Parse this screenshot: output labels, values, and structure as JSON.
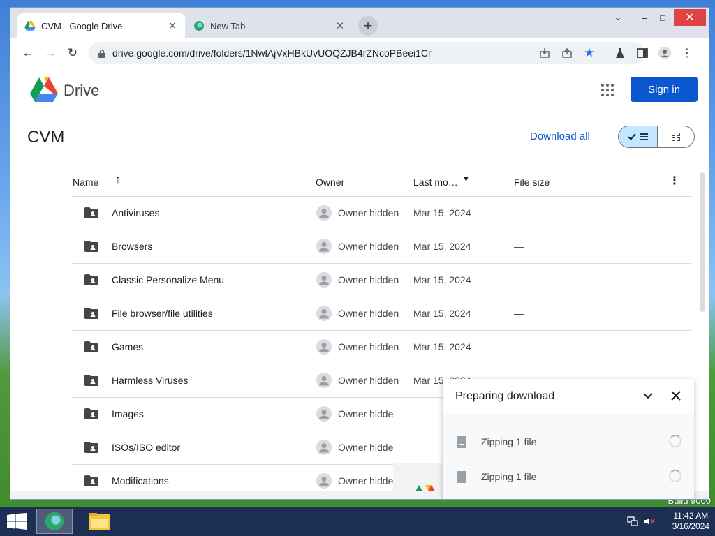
{
  "browser": {
    "tabs": [
      {
        "title": "CVM - Google Drive",
        "active": true
      },
      {
        "title": "New Tab",
        "active": false
      }
    ],
    "new_tab_label": "+",
    "url": "drive.google.com/drive/folders/1NwlAjVxHBkUvUOQZJB4rZNcoPBeei1Cr",
    "window_controls": {
      "collapse": "⌄",
      "minimize": "–",
      "maximize": "□",
      "close": "✕"
    }
  },
  "drive": {
    "brand": "Drive",
    "sign_in": "Sign in",
    "folder_title": "CVM",
    "download_all": "Download all",
    "columns": {
      "name": "Name",
      "owner": "Owner",
      "last_modified": "Last mo…",
      "file_size": "File size"
    },
    "rows": [
      {
        "name": "Antiviruses",
        "owner": "Owner hidden",
        "date": "Mar 15, 2024",
        "size": "—"
      },
      {
        "name": "Browsers",
        "owner": "Owner hidden",
        "date": "Mar 15, 2024",
        "size": "—"
      },
      {
        "name": "Classic Personalize Menu",
        "owner": "Owner hidden",
        "date": "Mar 15, 2024",
        "size": "—"
      },
      {
        "name": "File browser/file utilities",
        "owner": "Owner hidden",
        "date": "Mar 15, 2024",
        "size": "—"
      },
      {
        "name": "Games",
        "owner": "Owner hidden",
        "date": "Mar 15, 2024",
        "size": "—"
      },
      {
        "name": "Harmless Viruses",
        "owner": "Owner hidden",
        "date": "Mar 15, 2024",
        "size": "—"
      },
      {
        "name": "Images",
        "owner": "Owner hidde",
        "date": "",
        "size": ""
      },
      {
        "name": "ISOs/ISO editor",
        "owner": "Owner hidde",
        "date": "",
        "size": ""
      },
      {
        "name": "Modifications",
        "owner": "Owner hidde",
        "date": "Mar 15",
        "size": ""
      }
    ]
  },
  "download_panel": {
    "title": "Preparing download",
    "items": [
      {
        "label": "Zipping 1 file"
      },
      {
        "label": "Zipping 1 file"
      }
    ]
  },
  "desktop": {
    "watermark": "Build 9000"
  },
  "taskbar": {
    "time": "11:42 AM",
    "date": "3/16/2024"
  },
  "colors": {
    "accent": "#0b57d0",
    "toggle_selected": "#c2e7ff",
    "close_red": "#e04343",
    "taskbar": "#1d2f55"
  }
}
